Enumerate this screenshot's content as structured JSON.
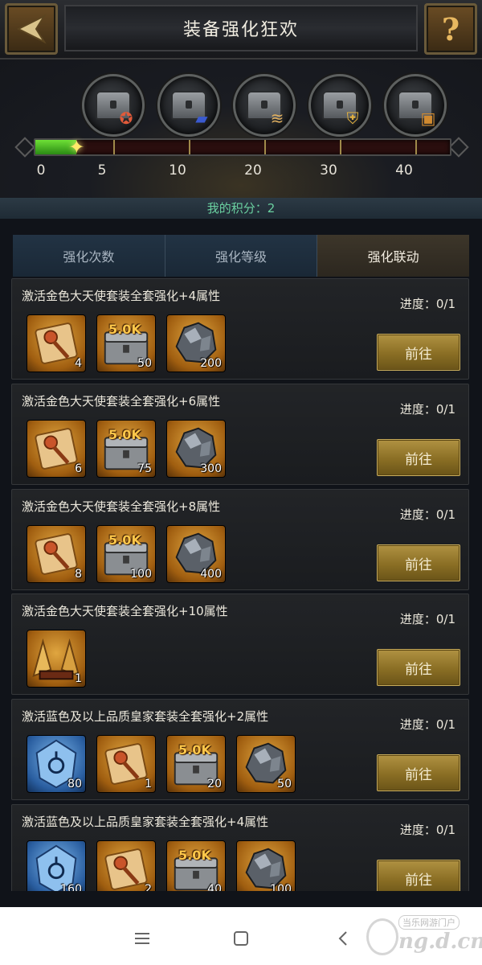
{
  "header": {
    "title": "装备强化狂欢",
    "back_icon": "back-arrow-icon",
    "help_icon": "question-mark-icon",
    "help_glyph": "?"
  },
  "milestones": {
    "chests": [
      {
        "reward_icon": "star-badge-icon"
      },
      {
        "reward_icon": "blue-book-icon"
      },
      {
        "reward_icon": "scroll-icon"
      },
      {
        "reward_icon": "shield-icon"
      },
      {
        "reward_icon": "treasure-chest-icon"
      }
    ],
    "ticks": [
      "0",
      "5",
      "10",
      "20",
      "30",
      "40"
    ],
    "current_score": 2,
    "max_score": 40
  },
  "score": {
    "text": "我的积分：2"
  },
  "tabs": [
    {
      "label": "强化次数",
      "active": false
    },
    {
      "label": "强化等级",
      "active": false
    },
    {
      "label": "强化联动",
      "active": true
    }
  ],
  "tasks": [
    {
      "title": "激活金色大天使套装全套强化+4属性",
      "progress": "进度：0/1",
      "button": "前往",
      "items": [
        {
          "icon": "scroll-key-icon",
          "tier": "gold",
          "count": "4"
        },
        {
          "icon": "gold-chest-icon",
          "tier": "gold",
          "badge": "5.0K",
          "count": "50"
        },
        {
          "icon": "iron-ore-icon",
          "tier": "gold",
          "count": "200"
        }
      ]
    },
    {
      "title": "激活金色大天使套装全套强化+6属性",
      "progress": "进度：0/1",
      "button": "前往",
      "items": [
        {
          "icon": "scroll-key-icon",
          "tier": "gold",
          "count": "6"
        },
        {
          "icon": "gold-chest-icon",
          "tier": "gold",
          "badge": "5.0K",
          "count": "75"
        },
        {
          "icon": "iron-ore-icon",
          "tier": "gold",
          "count": "300"
        }
      ]
    },
    {
      "title": "激活金色大天使套装全套强化+8属性",
      "progress": "进度：0/1",
      "button": "前往",
      "items": [
        {
          "icon": "scroll-key-icon",
          "tier": "gold",
          "count": "8"
        },
        {
          "icon": "gold-chest-icon",
          "tier": "gold",
          "badge": "5.0K",
          "count": "100"
        },
        {
          "icon": "iron-ore-icon",
          "tier": "gold",
          "count": "400"
        }
      ]
    },
    {
      "title": "激活金色大天使套装全套强化+10属性",
      "progress": "进度：0/1",
      "button": "前往",
      "items": [
        {
          "icon": "golden-wings-icon",
          "tier": "gold",
          "count": "1"
        }
      ]
    },
    {
      "title": "激活蓝色及以上品质皇家套装全套强化+2属性",
      "progress": "进度：0/1",
      "button": "前往",
      "items": [
        {
          "icon": "blue-rune-icon",
          "tier": "blue",
          "count": "80"
        },
        {
          "icon": "scroll-key-icon",
          "tier": "gold",
          "count": "1"
        },
        {
          "icon": "gold-chest-icon",
          "tier": "gold",
          "badge": "5.0K",
          "count": "20"
        },
        {
          "icon": "iron-ore-icon",
          "tier": "gold",
          "count": "50"
        }
      ]
    },
    {
      "title": "激活蓝色及以上品质皇家套装全套强化+4属性",
      "progress": "进度：0/1",
      "button": "前往",
      "items": [
        {
          "icon": "blue-rune-icon",
          "tier": "blue",
          "count": "160"
        },
        {
          "icon": "scroll-key-icon",
          "tier": "gold",
          "count": "2"
        },
        {
          "icon": "gold-chest-icon",
          "tier": "gold",
          "badge": "5.0K",
          "count": "40"
        },
        {
          "icon": "iron-ore-icon",
          "tier": "gold",
          "count": "100"
        }
      ]
    }
  ],
  "navbar": {
    "menu_icon": "menu-icon",
    "home_icon": "home-square-icon",
    "back_icon": "back-chevron-icon"
  },
  "watermark": {
    "top": "当乐网游门户",
    "bottom": "ng.d.cn"
  },
  "colors": {
    "button_gold": "#a38536",
    "progress_green": "#4cc82a",
    "score_text": "#6ad0a0"
  }
}
